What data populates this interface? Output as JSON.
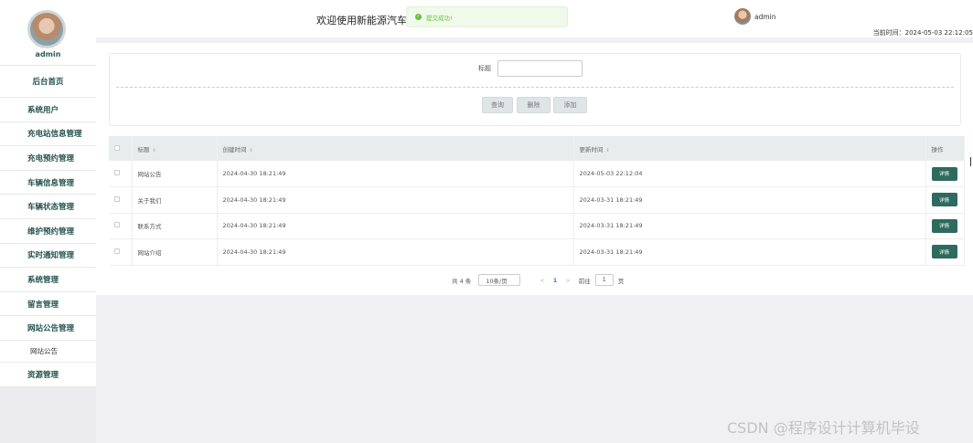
{
  "sidebar": {
    "username": "admin",
    "items": [
      {
        "label": "后台首页"
      },
      {
        "label": "系统用户"
      },
      {
        "label": "充电站信息管理"
      },
      {
        "label": "充电预约管理"
      },
      {
        "label": "车辆信息管理"
      },
      {
        "label": "车辆状态管理"
      },
      {
        "label": "维护预约管理"
      },
      {
        "label": "实时通知管理"
      },
      {
        "label": "系统管理"
      },
      {
        "label": "留言管理"
      },
      {
        "label": "网站公告管理"
      }
    ],
    "subitem": "网站公告",
    "last_item": "资源管理"
  },
  "header": {
    "welcome": "欢迎使用新能源汽车服",
    "toast": "提交成功!",
    "user": "admin",
    "time": "当前时间：2024-05-03 22:12:05"
  },
  "search": {
    "label": "标题",
    "value": "",
    "buttons": {
      "query": "查询",
      "delete": "删除",
      "add": "添加"
    }
  },
  "table": {
    "headers": {
      "title": "标题",
      "created": "创建时间",
      "updated": "更新时间",
      "ops": "操作"
    },
    "sort_icon": "⇕",
    "detail_label": "详情",
    "rows": [
      {
        "title": "网站公告",
        "created": "2024-04-30 18:21:49",
        "updated": "2024-05-03 22:12:04"
      },
      {
        "title": "关于我们",
        "created": "2024-04-30 18:21:49",
        "updated": "2024-03-31 18:21:49"
      },
      {
        "title": "联系方式",
        "created": "2024-04-30 18:21:49",
        "updated": "2024-03-31 18:21:49"
      },
      {
        "title": "网站介绍",
        "created": "2024-04-30 18:21:49",
        "updated": "2024-03-31 18:21:49"
      }
    ]
  },
  "pager": {
    "total": "共 4 条",
    "page_size": "10条/页",
    "prev": "<",
    "current": "1",
    "next": ">",
    "goto": "前往",
    "goto_value": "1",
    "page_unit": "页"
  },
  "watermark": "CSDN @程序设计计算机毕设",
  "colors": {
    "accent": "#2e6a5e",
    "success": "#67c23a"
  }
}
